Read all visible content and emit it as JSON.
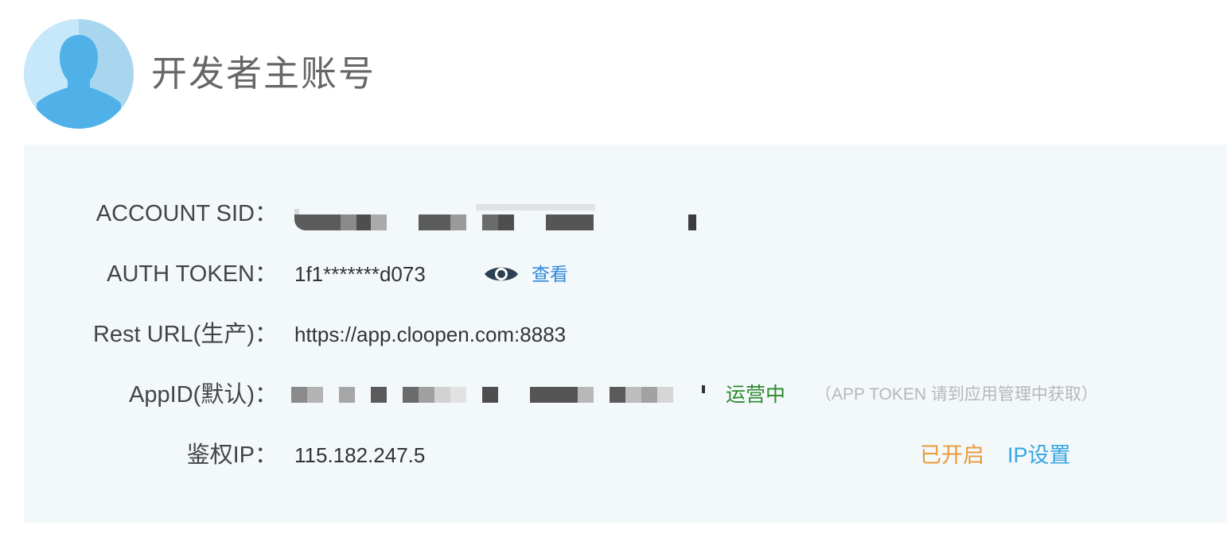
{
  "header": {
    "title": "开发者主账号",
    "avatar_icon": "user-silhouette-icon"
  },
  "colors": {
    "panel_bg": "#f3f8fb",
    "link_blue": "#2f8ad8",
    "running_green": "#2e8a2e",
    "enabled_orange": "#e89a3a",
    "ip_link_blue": "#35a6e0"
  },
  "fields": {
    "account_sid": {
      "label": "ACCOUNT SID",
      "colon": "：",
      "value": "",
      "redacted": true
    },
    "auth_token": {
      "label": "AUTH TOKEN",
      "colon": "：",
      "value": "1f1*******d073",
      "view_icon": "eye-icon",
      "view_label": "查看"
    },
    "rest_url": {
      "label": "Rest URL(生产)",
      "colon": "：",
      "value": "https://app.cloopen.com:8883"
    },
    "app_id": {
      "label": "AppID(默认)",
      "colon": "：",
      "value": "",
      "redacted": true,
      "status": "运营中",
      "hint": "（APP TOKEN 请到应用管理中获取）"
    },
    "auth_ip": {
      "label": "鉴权IP",
      "colon": "：",
      "value": "115.182.247.5",
      "status": "已开启",
      "settings_label": "IP设置"
    }
  }
}
